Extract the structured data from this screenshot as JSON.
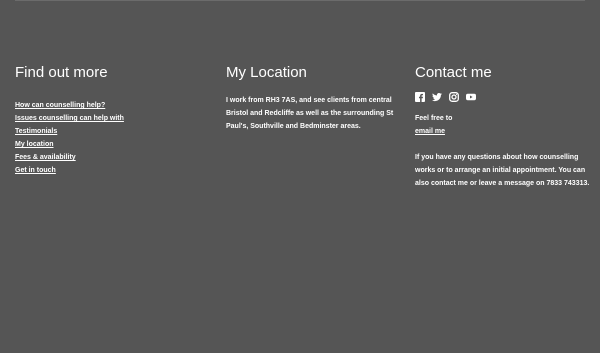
{
  "find_out_more": {
    "heading": "Find out more",
    "links": [
      "How can counselling help?",
      "Issues counselling can help with",
      "Testimonials",
      "My location",
      "Fees & availability",
      "Get in touch"
    ]
  },
  "my_location": {
    "heading": "My Location",
    "text": "I work from RH3 7AS, and see clients from central Bristol and Redcliffe as well as the surrounding St Paul's, Southville and Bedminster areas."
  },
  "contact_me": {
    "heading": "Contact me",
    "social_icons": [
      "facebook-icon",
      "twitter-icon",
      "instagram-icon",
      "youtube-icon"
    ],
    "feel_free": "Feel free to",
    "email_link": "email me",
    "text": "If you have any questions about how counselling works or to arrange an initial appointment. You can also contact me or leave a message on 7833 743313."
  },
  "colors": {
    "background": "#555555",
    "text": "#ffffff"
  }
}
